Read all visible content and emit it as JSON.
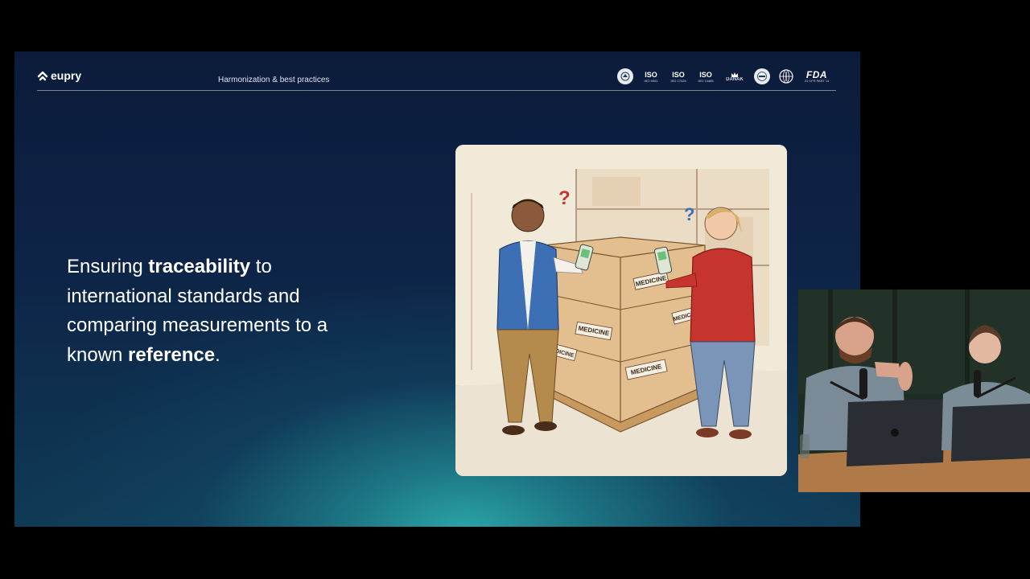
{
  "slide": {
    "brand": "eupry",
    "section_title": "Harmonization & best practices",
    "badges": [
      {
        "name": "circle-seal-1",
        "main": "",
        "sub": ""
      },
      {
        "name": "iso-9001",
        "main": "ISO",
        "sub": "ISO 9001"
      },
      {
        "name": "iso-17025",
        "main": "ISO",
        "sub": "ISO 17025"
      },
      {
        "name": "iso-13485",
        "main": "ISO",
        "sub": "ISO 13485"
      },
      {
        "name": "danak",
        "main": "DANAK",
        "sub": ""
      },
      {
        "name": "circle-seal-2",
        "main": "",
        "sub": ""
      },
      {
        "name": "who",
        "main": "",
        "sub": ""
      },
      {
        "name": "fda",
        "main": "FDA",
        "sub": "21 CFR PART 11"
      }
    ],
    "headline": {
      "part1": "Ensuring ",
      "bold1": "traceability",
      "part2": " to international standards and comparing measurements to a known ",
      "bold2": "reference",
      "part3": "."
    },
    "illustration": {
      "box_label": "MEDICINE",
      "question_mark": "?"
    }
  },
  "colors": {
    "slide_top": "#0c1b3a",
    "slide_glow": "#2aa7a8",
    "text": "#ffffff",
    "vest_blue": "#3c6fb4",
    "jacket_red": "#c6342e"
  }
}
